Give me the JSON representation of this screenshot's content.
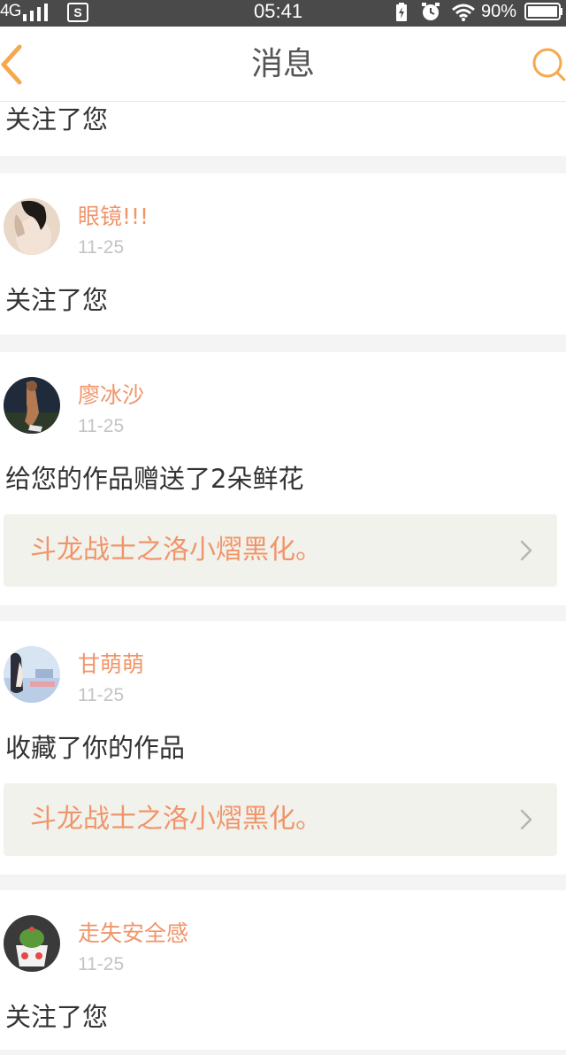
{
  "status_bar": {
    "network": "4G",
    "time": "05:41",
    "battery": "90%",
    "sim_icon_letter": "S",
    "icons": [
      "signal-icon",
      "sim-icon",
      "charging-icon",
      "alarm-icon",
      "wifi-icon",
      "battery-icon"
    ]
  },
  "header": {
    "title": "消息",
    "back_icon": "chevron-left-icon",
    "search_icon": "search-icon",
    "accent_color": "#f5a84e"
  },
  "colors": {
    "username": "#f0956a",
    "work_title": "#f0956a",
    "date": "#c4c4c4",
    "separator": "#f4f4f4",
    "work_box_bg": "#f2f2ed"
  },
  "top_partial": {
    "action": "关注了您"
  },
  "notifications": [
    {
      "username": "眼镜!!!",
      "date": "11-25",
      "action": "关注了您"
    },
    {
      "username": "廖冰沙",
      "date": "11-25",
      "action": "给您的作品赠送了2朵鲜花",
      "work_title": "斗龙战士之洛小熠黑化。"
    },
    {
      "username": "甘萌萌",
      "date": "11-25",
      "action": "收藏了你的作品",
      "work_title": "斗龙战士之洛小熠黑化。"
    },
    {
      "username": "走失安全感",
      "date": "11-25",
      "action": "关注了您"
    }
  ]
}
